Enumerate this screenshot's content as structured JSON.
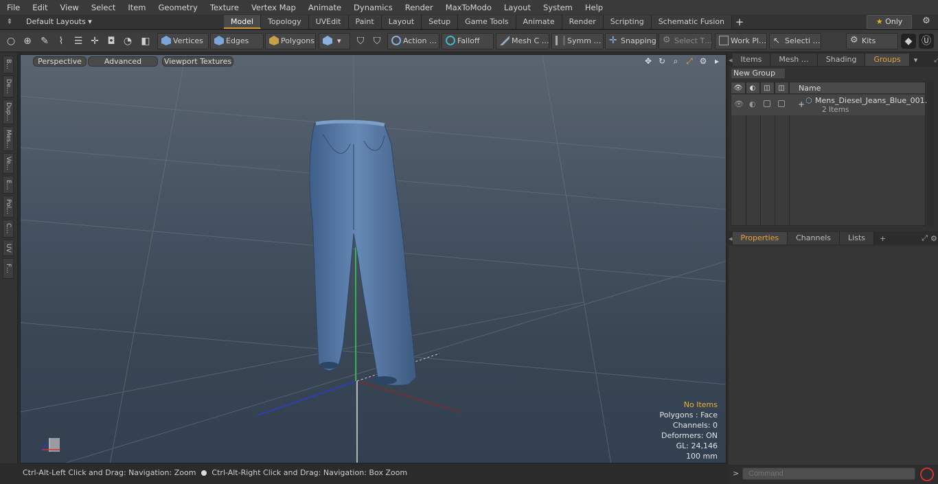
{
  "menu": [
    "File",
    "Edit",
    "View",
    "Select",
    "Item",
    "Geometry",
    "Texture",
    "Vertex Map",
    "Animate",
    "Dynamics",
    "Render",
    "MaxToModo",
    "Layout",
    "System",
    "Help"
  ],
  "layouts": "Default Layouts ▾",
  "tabs": [
    "Model",
    "Topology",
    "UVEdit",
    "Paint",
    "Layout",
    "Setup",
    "Game Tools",
    "Animate",
    "Render",
    "Scripting",
    "Schematic Fusion"
  ],
  "active_tab": "Model",
  "only_label": "Only",
  "toolbar": {
    "vertices": "Vertices",
    "edges": "Edges",
    "polygons": "Polygons",
    "action": "Action",
    "action_more": "…",
    "falloff": "Falloff",
    "meshc": "Mesh C …",
    "symm": "Symm …",
    "snapping": "Snapping",
    "selectt": "Select T…",
    "workpl": "Work Pl…",
    "selecti": "Selecti …",
    "kits": "Kits"
  },
  "left_tabs": [
    "B…",
    "De…",
    "Dup…",
    "Mes…",
    "Ve…",
    "E…",
    "Pol…",
    "C…",
    "UV",
    "F…"
  ],
  "viewport": {
    "perspective": "Perspective",
    "advanced": "Advanced",
    "textures": "Viewport Textures",
    "info": {
      "no_items": "No Items",
      "polygons": "Polygons : Face",
      "channels": "Channels: 0",
      "deformers": "Deformers: ON",
      "gl": "GL: 24,146",
      "scale": "100 mm"
    }
  },
  "status": {
    "left": "Ctrl-Alt-Left Click and Drag: Navigation: Zoom",
    "right": "Ctrl-Alt-Right Click and Drag: Navigation: Box Zoom"
  },
  "panel_top_tabs": [
    "Items",
    "Mesh …",
    "Shading",
    "Groups"
  ],
  "panel_top_active": "Groups",
  "new_group": "New Group",
  "groups_header": "Name",
  "group_item": {
    "name": "Mens_Diesel_Jeans_Blue_001…",
    "count": "2 Items"
  },
  "panel_bottom_tabs": [
    "Properties",
    "Channels",
    "Lists"
  ],
  "panel_bottom_active": "Properties",
  "command_placeholder": "Command",
  "colors": {
    "accent": "#e6a23c",
    "active_tab_underline": "#d79a2e",
    "warning": "#f0b030"
  }
}
